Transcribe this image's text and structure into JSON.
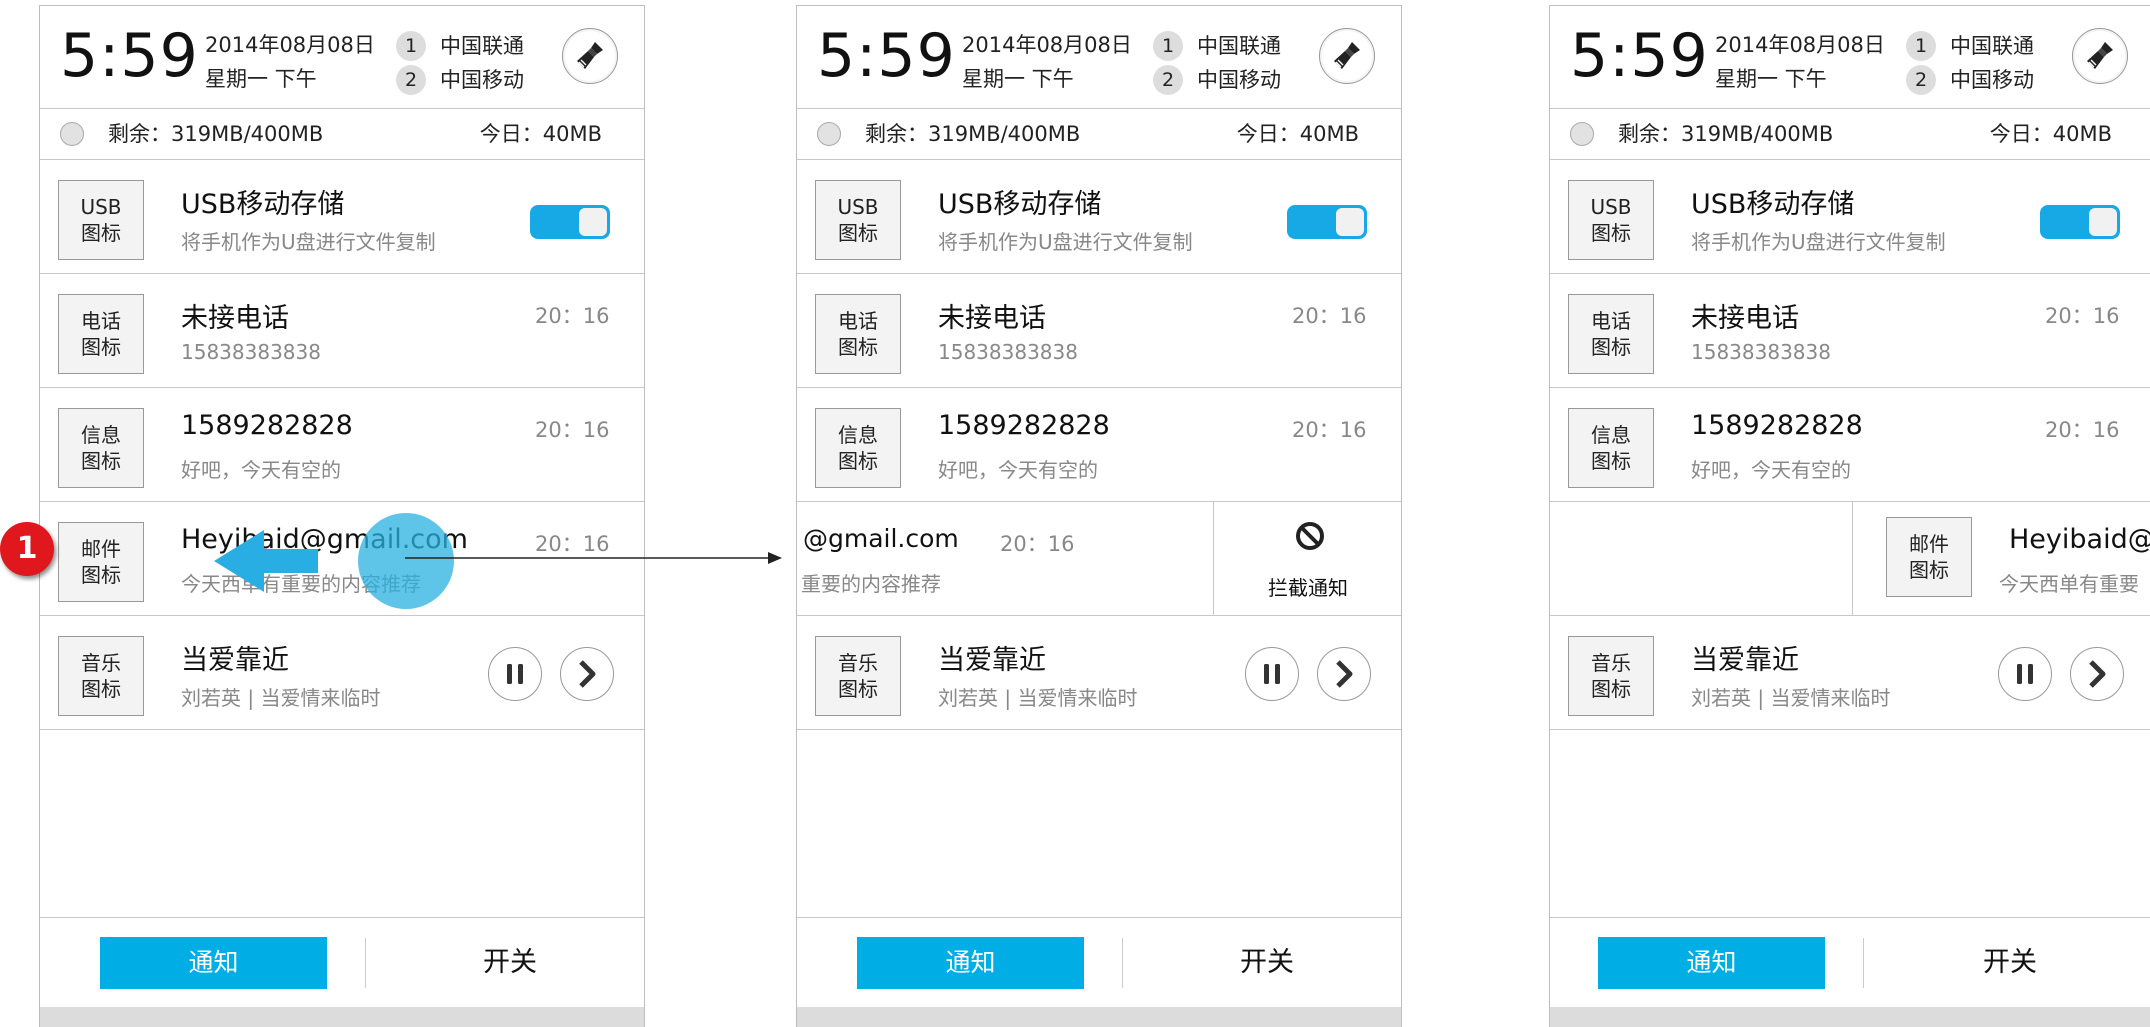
{
  "panels": [
    {
      "status": {
        "time": "5:59",
        "date": "2014年08月08日",
        "weekday": "星期一 下午",
        "sims": [
          {
            "num": "1",
            "name": "中国联通"
          },
          {
            "num": "2",
            "name": "中国移动"
          }
        ]
      },
      "data_usage": {
        "remaining": "剩余：319MB/400MB",
        "today": "今日：40MB"
      },
      "usb": {
        "icon_l1": "USB",
        "icon_l2": "图标",
        "title": "USB移动存储",
        "subtitle": "将手机作为U盘进行文件复制",
        "enabled": true
      },
      "call": {
        "icon_l1": "电话",
        "icon_l2": "图标",
        "title": "未接电话",
        "subtitle": "15838383838",
        "time": "20：16"
      },
      "sms": {
        "icon_l1": "信息",
        "icon_l2": "图标",
        "title": "1589282828",
        "subtitle": "好吧，今天有空的",
        "time": "20：16"
      },
      "mail": {
        "icon_l1": "邮件",
        "icon_l2": "图标",
        "title": "Heyibaid@gmail.com",
        "subtitle": "今天西单有重要的内容推荐",
        "time": "20：16"
      },
      "music": {
        "icon_l1": "音乐",
        "icon_l2": "图标",
        "title": "当爱靠近",
        "subtitle": "刘若英 | 当爱情来临时"
      },
      "tabs": {
        "notify": "通知",
        "switch": "开关"
      },
      "step_marker": "1"
    },
    {
      "status": {
        "time": "5:59",
        "date": "2014年08月08日",
        "weekday": "星期一 下午",
        "sims": [
          {
            "num": "1",
            "name": "中国联通"
          },
          {
            "num": "2",
            "name": "中国移动"
          }
        ]
      },
      "data_usage": {
        "remaining": "剩余：319MB/400MB",
        "today": "今日：40MB"
      },
      "usb": {
        "icon_l1": "USB",
        "icon_l2": "图标",
        "title": "USB移动存储",
        "subtitle": "将手机作为U盘进行文件复制",
        "enabled": true
      },
      "call": {
        "icon_l1": "电话",
        "icon_l2": "图标",
        "title": "未接电话",
        "subtitle": "15838383838",
        "time": "20：16"
      },
      "sms": {
        "icon_l1": "信息",
        "icon_l2": "图标",
        "title": "1589282828",
        "subtitle": "好吧，今天有空的",
        "time": "20：16"
      },
      "mail_swiped": {
        "title": "@gmail.com",
        "time": "20：16",
        "subtitle": "重要的内容推荐",
        "block_label": "拦截通知"
      },
      "music": {
        "icon_l1": "音乐",
        "icon_l2": "图标",
        "title": "当爱靠近",
        "subtitle": "刘若英 | 当爱情来临时"
      },
      "tabs": {
        "notify": "通知",
        "switch": "开关"
      }
    },
    {
      "status": {
        "time": "5:59",
        "date": "2014年08月08日",
        "weekday": "星期一 下午",
        "sims": [
          {
            "num": "1",
            "name": "中国联通"
          },
          {
            "num": "2",
            "name": "中国移动"
          }
        ]
      },
      "data_usage": {
        "remaining": "剩余：319MB/400MB",
        "today": "今日：40MB"
      },
      "usb": {
        "icon_l1": "USB",
        "icon_l2": "图标",
        "title": "USB移动存储",
        "subtitle": "将手机作为U盘进行文件复制",
        "enabled": true
      },
      "call": {
        "icon_l1": "电话",
        "icon_l2": "图标",
        "title": "未接电话",
        "subtitle": "15838383838",
        "time": "20：16"
      },
      "sms": {
        "icon_l1": "信息",
        "icon_l2": "图标",
        "title": "1589282828",
        "subtitle": "好吧，今天有空的",
        "time": "20：16"
      },
      "mail_slid": {
        "icon_l1": "邮件",
        "icon_l2": "图标",
        "title": "Heyibaid@",
        "subtitle": "今天西单有重要"
      },
      "music": {
        "icon_l1": "音乐",
        "icon_l2": "图标",
        "title": "当爱靠近",
        "subtitle": "刘若英 | 当爱情来临时"
      },
      "tabs": {
        "notify": "通知",
        "switch": "开关"
      }
    }
  ],
  "colors": {
    "accent": "#00aee6",
    "toggle_on": "#17a9e6",
    "marker": "#e0171c",
    "touch": "#28b2e2"
  },
  "icons": {
    "clean": "brush-icon",
    "pause": "pause-icon",
    "next": "chevron-right-icon",
    "block": "block-icon",
    "swipe": "arrow-left-icon"
  }
}
